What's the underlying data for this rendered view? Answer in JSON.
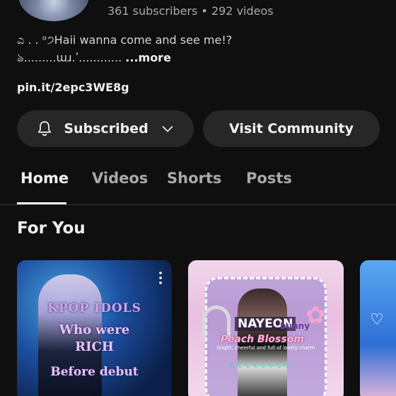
{
  "channel": {
    "stats": "361 subscribers • 292 videos",
    "description_line1": "ಎ . . ᵒ੭Haii wanna come and see me!?",
    "description_line2": "ঌ.........ɯɹ.ʹ............ ",
    "more_label": "...more",
    "link": "pin.it/2epc3WE8g"
  },
  "actions": {
    "subscribed_label": "Subscribed",
    "community_label": "Visit Community"
  },
  "tabs": [
    {
      "label": "Home",
      "active": true
    },
    {
      "label": "Videos",
      "active": false
    },
    {
      "label": "Shorts",
      "active": false
    },
    {
      "label": "Posts",
      "active": false
    }
  ],
  "section": {
    "title": "For You"
  },
  "cards": [
    {
      "overlay_lines": [
        "KPOP IDOLS",
        "Who were",
        "RICH",
        "Before debut"
      ]
    },
    {
      "name": "NAYEON",
      "tag": "bunny",
      "subtitle": "Peach Blossom",
      "blurb": "bright, cheerful and full of lovely charm"
    },
    {
      "icon": "heart-icon"
    }
  ],
  "colors": {
    "background": "#0f0f0f",
    "button": "#272727",
    "text_primary": "#f1f1f1",
    "text_secondary": "#aaaaaa"
  }
}
